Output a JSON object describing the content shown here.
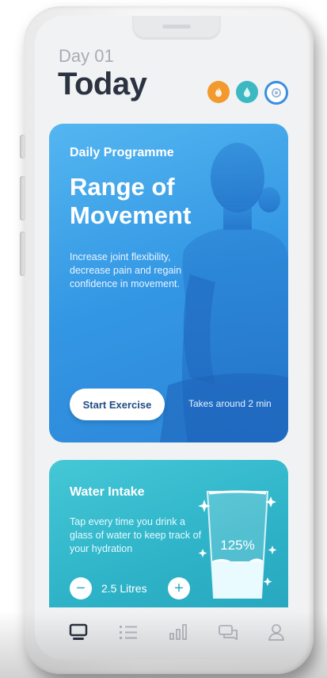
{
  "header": {
    "day_label": "Day 01",
    "title": "Today"
  },
  "stats": {
    "icons": [
      "flame-icon",
      "water-drop-icon",
      "progress-ring-icon"
    ],
    "colors": {
      "orange": "#f29a2e",
      "teal": "#3bb8c2",
      "blue": "#3a8ee0"
    }
  },
  "program": {
    "kicker": "Daily Programme",
    "title": "Range of Movement",
    "description": "Increase joint flexibility, decrease pain and regain confidence in movement.",
    "start_label": "Start Exercise",
    "duration": "Takes around 2 min"
  },
  "water": {
    "title": "Water Intake",
    "description": "Tap every time you drink a glass of water to keep track of your hydration",
    "percent": "125%",
    "quantity": "2.5 Litres",
    "minus_label": "−",
    "plus_label": "+"
  },
  "tabs": [
    {
      "icon": "monitor-icon",
      "active": true
    },
    {
      "icon": "list-icon",
      "active": false
    },
    {
      "icon": "bar-chart-icon",
      "active": false
    },
    {
      "icon": "chat-icon",
      "active": false
    },
    {
      "icon": "profile-icon",
      "active": false
    }
  ]
}
